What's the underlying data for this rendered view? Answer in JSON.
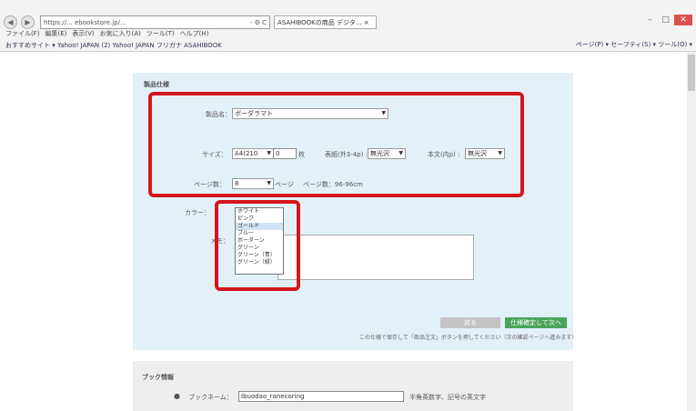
{
  "browser": {
    "url": "https://... ebookstore.jp/...",
    "address_extra": "- ⚙ C",
    "tab_title": "ASAHIBOOKの商品 デジタ... ×",
    "menu": [
      "ファイル(F)",
      "編集(E)",
      "表示(V)",
      "お気に入り(A)",
      "ツール(T)",
      "ヘルプ(H)"
    ],
    "favorites": "おすすめサイト ▾  Yahoo! JAPAN (2)  Yahoo! JAPAN  フリガナ ASAHIBOOK",
    "toolbar": "ページ(P) ▾  セーフティ(S) ▾  ツール(O) ▾"
  },
  "form": {
    "section_title": "製品仕様",
    "product_label": "製品名：",
    "product_value": "ボーダラマト",
    "size_label": "サイズ：",
    "size_value": "A4(210",
    "size_value2": "0",
    "size_unit": "枚",
    "paper1_label": "表紙(外3-4p) :",
    "paper1_value": "無光沢",
    "paper2_label": "本文(内p) :",
    "paper2_value": "無光沢",
    "pages_label": "ページ数：",
    "pages_value": "8",
    "pages_unit": "ページ",
    "pages_note": "ページ数：96-96cm",
    "color_label": "カラー：",
    "memo_label": "メモ：",
    "color_options": [
      "ホワイト",
      "ピンク",
      "ゴールド",
      "ブルー",
      "ボーダーン",
      "グリーン",
      "グリーン（青）",
      "グリーン（緑）"
    ],
    "highlighted_option": 2,
    "btn_back": "戻る",
    "btn_next": "仕様確定して次へ",
    "footer_note": "この仕様で保存して「商品注文」ボタンを押してください（次の確認ページへ進みます）"
  },
  "account": {
    "title": "ブック情報",
    "name_label": "ブックネーム：",
    "name_value": "Ibuodao_ranecoring",
    "name_note": "半角英数字、記号の英文字"
  }
}
